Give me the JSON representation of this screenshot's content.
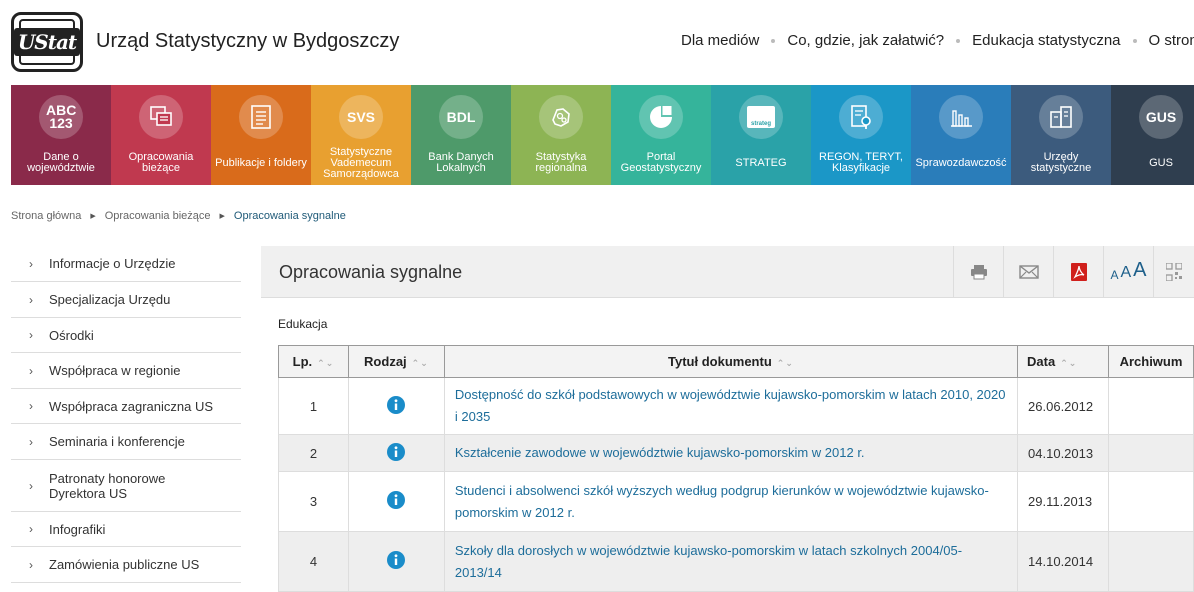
{
  "header": {
    "logo_text": "UStat",
    "site_title": "Urząd Statystyczny w Bydgoszczy",
    "nav": [
      "Dla mediów",
      "Co, gdzie, jak załatwić?",
      "Edukacja statystyczna",
      "O stronie"
    ]
  },
  "tiles": [
    {
      "label": "Dane o województwie",
      "icon": "abc-123-icon",
      "icon_text": "ABC 123",
      "color": "#8a2a4a"
    },
    {
      "label": "Opracowania bieżące",
      "icon": "documents-icon",
      "icon_text": "",
      "color": "#c0394f"
    },
    {
      "label": "Publikacje i foldery",
      "icon": "list-document-icon",
      "icon_text": "",
      "color": "#d96b1b"
    },
    {
      "label": "Statystyczne Vademecum Samorządowca",
      "icon": "svs-icon",
      "icon_text": "SVS",
      "color": "#e8a030"
    },
    {
      "label": "Bank Danych Lokalnych",
      "icon": "bdl-icon",
      "icon_text": "BDL",
      "color": "#4e9a6a"
    },
    {
      "label": "Statystyka regionalna",
      "icon": "region-map-icon",
      "icon_text": "",
      "color": "#8db454"
    },
    {
      "label": "Portal Geostatystyczny",
      "icon": "geo-portal-icon",
      "icon_text": "",
      "color": "#35b49b"
    },
    {
      "label": "STRATEG",
      "icon": "strateg-icon",
      "icon_text": "strateg",
      "color": "#2aa2a8"
    },
    {
      "label": "REGON, TERYT, Klasyfikacje",
      "icon": "document-search-icon",
      "icon_text": "",
      "color": "#1b97c7"
    },
    {
      "label": "Sprawozdawczość",
      "icon": "bar-chart-icon",
      "icon_text": "",
      "color": "#2a7dba"
    },
    {
      "label": "Urzędy statystyczne",
      "icon": "buildings-icon",
      "icon_text": "",
      "color": "#3c5b7d"
    },
    {
      "label": "GUS",
      "icon": "gus-icon",
      "icon_text": "GUS",
      "color": "#2f3e4f"
    }
  ],
  "breadcrumb": [
    "Strona główna",
    "Opracowania bieżące",
    "Opracowania sygnalne"
  ],
  "sidebar": {
    "items": [
      "Informacje o Urzędzie",
      "Specjalizacja Urzędu",
      "Ośrodki",
      "Współpraca w regionie",
      "Współpraca zagraniczna US",
      "Seminaria i konferencje",
      "Patronaty honorowe Dyrektora US",
      "Infografiki",
      "Zamówienia publiczne US"
    ]
  },
  "main": {
    "title": "Opracowania sygnalne",
    "tools": {
      "print": "print-icon",
      "email": "envelope-icon",
      "pdf": "pdf-icon",
      "font_size": "AAA",
      "qr": "qr-code-icon"
    },
    "font_sizes": [
      "A",
      "A",
      "A"
    ],
    "section_label": "Edukacja",
    "table": {
      "headers": [
        "Lp.",
        "Rodzaj",
        "Tytuł dokumentu",
        "Data",
        "Archiwum"
      ],
      "rows": [
        {
          "lp": "1",
          "rodzaj_icon": "info-icon",
          "title": "Dostępność do szkół podstawowych w województwie kujawsko-pomorskim w latach 2010, 2020 i 2035",
          "date": "26.06.2012",
          "archive": ""
        },
        {
          "lp": "2",
          "rodzaj_icon": "info-icon",
          "title": "Kształcenie zawodowe w województwie kujawsko-pomorskim w 2012 r.",
          "date": "04.10.2013",
          "archive": ""
        },
        {
          "lp": "3",
          "rodzaj_icon": "info-icon",
          "title": "Studenci i absolwenci szkół wyższych według podgrup kierunków w województwie kujawsko-pomorskim w 2012 r.",
          "date": "29.11.2013",
          "archive": ""
        },
        {
          "lp": "4",
          "rodzaj_icon": "info-icon",
          "title": "Szkoły dla dorosłych w województwie kujawsko-pomorskim w latach szkolnych 2004/05-2013/14",
          "date": "14.10.2014",
          "archive": ""
        }
      ]
    }
  },
  "colors": {
    "link": "#1d6d9a",
    "info_icon": "#1a8cc9",
    "pdf_red": "#d0201c"
  }
}
